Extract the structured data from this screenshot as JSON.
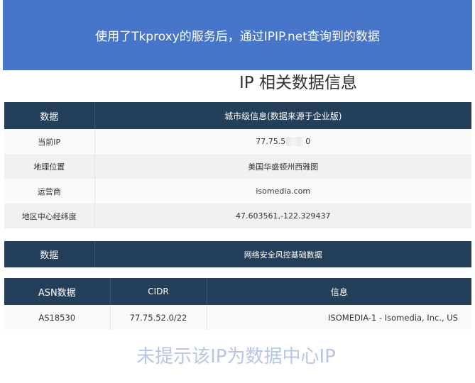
{
  "banner": {
    "text": "使用了Tkproxy的服务后，通过IPIP.net查询到的数据"
  },
  "section_title": "IP 相关数据信息",
  "city_table": {
    "header": {
      "col1": "数据",
      "col2": "城市级信息(数据来源于企业版)"
    },
    "rows": [
      {
        "label": "当前IP",
        "value_prefix": "77.75.5",
        "value_suffix": "0"
      },
      {
        "label": "地理位置",
        "value": "美国华盛顿州西雅图"
      },
      {
        "label": "运营商",
        "value": "isomedia.com"
      },
      {
        "label": "地区中心经纬度",
        "value": "47.603561,-122.329437"
      }
    ]
  },
  "risk_table": {
    "header": {
      "col1": "数据",
      "col2": "网络安全风控基础数据"
    }
  },
  "asn_table": {
    "header": {
      "asn": "ASN数据",
      "cidr": "CIDR",
      "info": "信息"
    },
    "rows": [
      {
        "asn": "AS18530",
        "cidr": "77.75.52.0/22",
        "info": "ISOMEDIA-1 - Isomedia, Inc., US"
      }
    ]
  },
  "verdict": "未提示该IP为数据中心IP"
}
